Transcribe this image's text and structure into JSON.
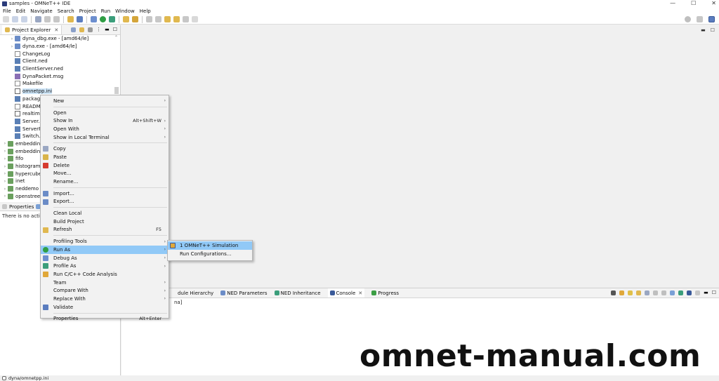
{
  "window": {
    "title": "samples - OMNeT++ IDE",
    "controls": [
      "—",
      "☐",
      "✕"
    ]
  },
  "menubar": [
    "File",
    "Edit",
    "Navigate",
    "Search",
    "Project",
    "Run",
    "Window",
    "Help"
  ],
  "project_explorer": {
    "tab_label": "Project Explorer",
    "close_glyph": "✕",
    "tree": [
      {
        "label": "dyna_dbg.exe - [amd64/le]",
        "icon": "exe",
        "arrow": "›",
        "indent": 1
      },
      {
        "label": "dyna.exe - [amd64/le]",
        "icon": "exe",
        "arrow": "›",
        "indent": 1
      },
      {
        "label": "ChangeLog",
        "icon": "text",
        "arrow": "",
        "indent": 1
      },
      {
        "label": "Client.ned",
        "icon": "ned",
        "arrow": "",
        "indent": 1
      },
      {
        "label": "ClientServer.ned",
        "icon": "ned",
        "arrow": "",
        "indent": 1
      },
      {
        "label": "DynaPacket.msg",
        "icon": "msg",
        "arrow": "",
        "indent": 1
      },
      {
        "label": "Makefile",
        "icon": "text",
        "arrow": "",
        "indent": 1
      },
      {
        "label": "omnetpp.ini",
        "icon": "ini",
        "arrow": "",
        "indent": 1,
        "selected": true
      },
      {
        "label": "packag",
        "icon": "ned",
        "arrow": "",
        "indent": 1
      },
      {
        "label": "READM",
        "icon": "text",
        "arrow": "",
        "indent": 1
      },
      {
        "label": "realtime",
        "icon": "ini",
        "arrow": "",
        "indent": 1
      },
      {
        "label": "Server.n",
        "icon": "ned",
        "arrow": "",
        "indent": 1
      },
      {
        "label": "ServerP",
        "icon": "ned",
        "arrow": "",
        "indent": 1
      },
      {
        "label": "Switch.n",
        "icon": "ned",
        "arrow": "",
        "indent": 1
      },
      {
        "label": "embedding",
        "icon": "proj",
        "arrow": "›",
        "indent": 0
      },
      {
        "label": "embedding",
        "icon": "proj",
        "arrow": "›",
        "indent": 0
      },
      {
        "label": "fifo",
        "icon": "proj",
        "arrow": "›",
        "indent": 0
      },
      {
        "label": "histograms",
        "icon": "proj",
        "arrow": "›",
        "indent": 0
      },
      {
        "label": "hypercube",
        "icon": "proj",
        "arrow": "›",
        "indent": 0
      },
      {
        "label": "inet",
        "icon": "proj",
        "arrow": "›",
        "indent": 0
      },
      {
        "label": "neddemo",
        "icon": "proj",
        "arrow": "›",
        "indent": 0
      },
      {
        "label": "openstreet",
        "icon": "proj",
        "arrow": "›",
        "indent": 0
      }
    ]
  },
  "properties": {
    "tab_label": "Properties",
    "message": "There is no active"
  },
  "context_menu": {
    "groups": [
      [
        {
          "label": "New",
          "submenu": true
        }
      ],
      [
        {
          "label": "Open"
        },
        {
          "label": "Show In",
          "shortcut": "Alt+Shift+W",
          "submenu": true
        },
        {
          "label": "Open With",
          "submenu": true
        },
        {
          "label": "Show in Local Terminal",
          "submenu": true
        }
      ],
      [
        {
          "label": "Copy",
          "icon": "copy"
        },
        {
          "label": "Paste",
          "icon": "paste"
        },
        {
          "label": "Delete",
          "icon": "delete"
        },
        {
          "label": "Move..."
        },
        {
          "label": "Rename..."
        }
      ],
      [
        {
          "label": "Import...",
          "icon": "import"
        },
        {
          "label": "Export...",
          "icon": "export"
        }
      ],
      [
        {
          "label": "Clean Local"
        },
        {
          "label": "Build Project"
        },
        {
          "label": "Refresh",
          "icon": "refresh",
          "shortcut": "F5"
        }
      ],
      [
        {
          "label": "Profiling Tools",
          "submenu": true
        },
        {
          "label": "Run As",
          "icon": "run",
          "submenu": true,
          "highlighted": true
        },
        {
          "label": "Debug As",
          "icon": "debug",
          "submenu": true
        },
        {
          "label": "Profile As",
          "icon": "profile",
          "submenu": true
        },
        {
          "label": "Run C/C++ Code Analysis",
          "icon": "analysis"
        },
        {
          "label": "Team",
          "submenu": true
        },
        {
          "label": "Compare With",
          "submenu": true
        },
        {
          "label": "Replace With",
          "submenu": true
        },
        {
          "label": "Validate",
          "icon": "validate"
        }
      ],
      [
        {
          "label": "Properties",
          "shortcut": "Alt+Enter"
        }
      ]
    ]
  },
  "run_as_submenu": [
    {
      "label": "1 OMNeT++ Simulation",
      "icon": "omnet",
      "highlighted": true
    },
    {
      "label": "Run Configurations..."
    }
  ],
  "bottom_panel": {
    "tabs": [
      {
        "label": "dule Hierarchy",
        "icon": "hierarchy"
      },
      {
        "label": "NED Parameters",
        "icon": "ned-params"
      },
      {
        "label": "NED Inheritance",
        "icon": "ned-inherit"
      },
      {
        "label": "Console",
        "icon": "console",
        "active": true,
        "close": "✕"
      },
      {
        "label": "Progress",
        "icon": "progress"
      }
    ],
    "console_text": "na]"
  },
  "statusbar": {
    "path": "dyna/omnetpp.ini"
  },
  "watermark": "omnet-manual.com",
  "colors": {
    "menu_highlight": "#91c9f7",
    "selection": "#cce4f7",
    "folder": "#d9b44a",
    "project": "#6aa05e"
  }
}
